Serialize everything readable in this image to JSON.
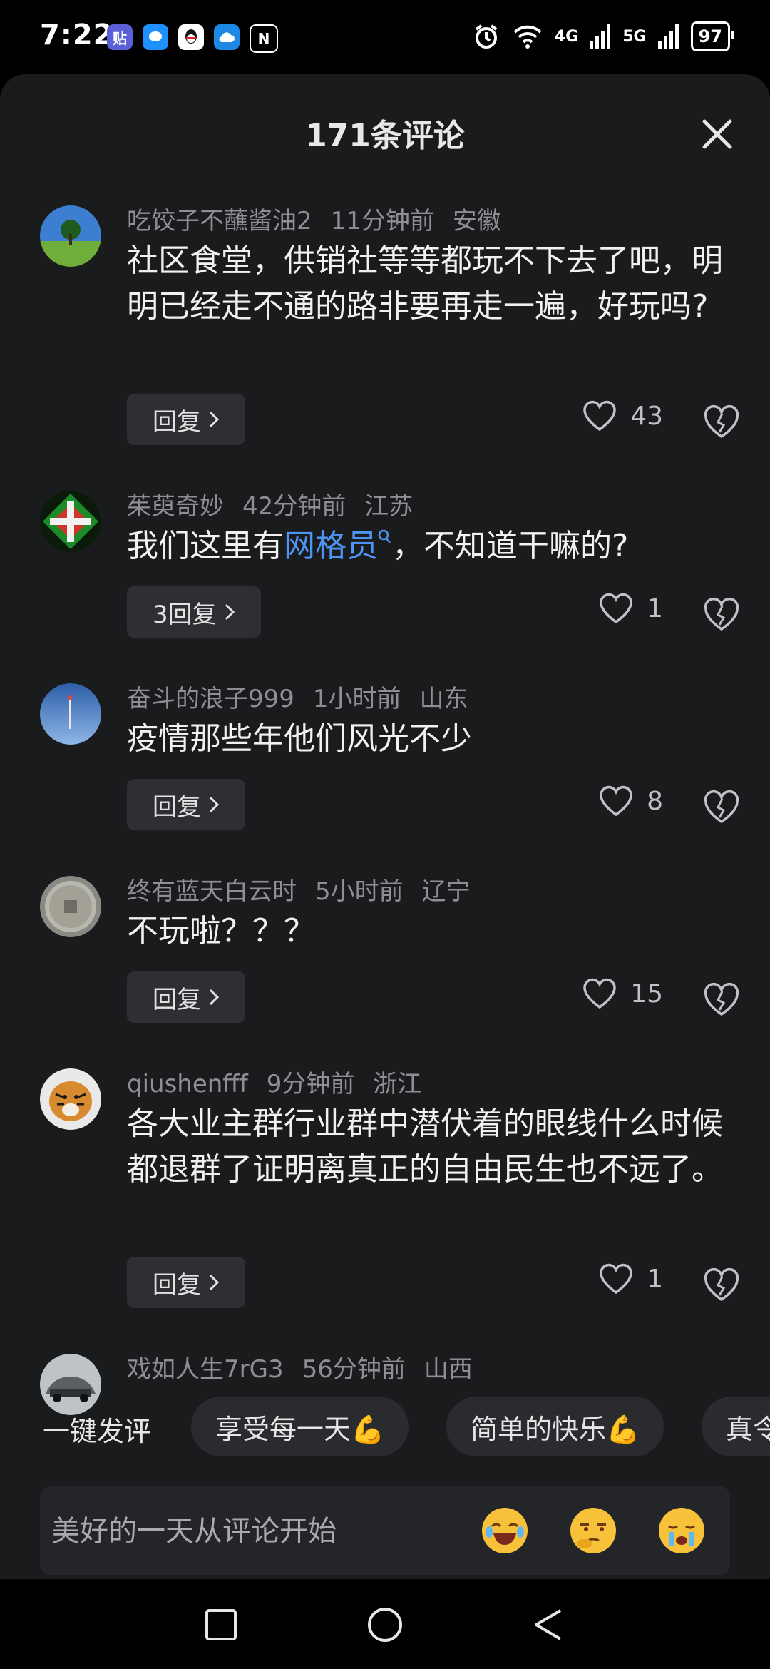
{
  "status": {
    "time": "7:22",
    "signal_4g": "4G",
    "signal_5g": "5G",
    "battery": "97"
  },
  "sheet": {
    "title": "171条评论"
  },
  "comments": [
    {
      "user": "吃饺子不蘸酱油2",
      "time": "11分钟前",
      "region": "安徽",
      "text": "社区食堂，供销社等等都玩不下去了吧，明明已经走不通的路非要再走一遍，好玩吗?",
      "reply_label": "回复",
      "likes": "43"
    },
    {
      "user": "茱萸奇妙",
      "time": "42分钟前",
      "region": "江苏",
      "text_before": "我们这里有",
      "link_text": "网格员",
      "text_after": "，不知道干嘛的?",
      "reply_label": "3回复",
      "likes": "1"
    },
    {
      "user": "奋斗的浪子999",
      "time": "1小时前",
      "region": "山东",
      "text": "疫情那些年他们风光不少",
      "reply_label": "回复",
      "likes": "8"
    },
    {
      "user": "终有蓝天白云时",
      "time": "5小时前",
      "region": "辽宁",
      "text": "不玩啦？？？",
      "reply_label": "回复",
      "likes": "15"
    },
    {
      "user": "qiushenfff",
      "time": "9分钟前",
      "region": "浙江",
      "text": "各大业主群行业群中潜伏着的眼线什么时候都退群了证明离真正的自由民生也不远了。",
      "reply_label": "回复",
      "likes": "1"
    },
    {
      "user": "戏如人生7rG3",
      "time": "56分钟前",
      "region": "山西"
    }
  ],
  "quick_reply": {
    "label": "一键发评",
    "chips": [
      "享受每一天💪",
      "简单的快乐💪",
      "真令"
    ]
  },
  "input": {
    "placeholder": "美好的一天从评论开始"
  },
  "colors": {
    "background": "#1a1b1d",
    "link": "#4e94f3",
    "button": "#2e2f33",
    "meta": "#8d8f93"
  }
}
